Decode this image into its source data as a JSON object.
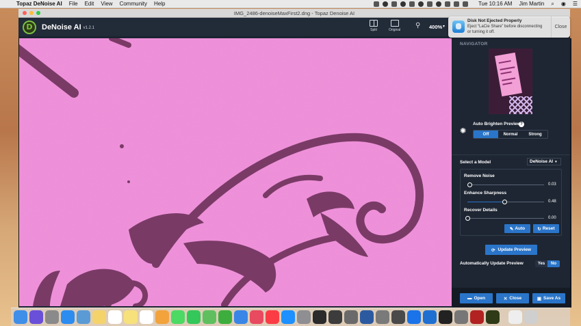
{
  "menubar": {
    "app_name": "Topaz DeNoise AI",
    "menus": [
      "File",
      "Edit",
      "View",
      "Community",
      "Help"
    ],
    "clock": "Tue 10:16 AM",
    "user": "Jim Martin"
  },
  "window": {
    "title": "IMG_2486-denoiseMaxFirst2.dng - Topaz Denoise AI"
  },
  "toolbar": {
    "logo_letter": "D",
    "app_title": "DeNoise AI",
    "version": "v1.2.1",
    "split_label": "Split",
    "original_label": "Original",
    "zoom_level": "400%"
  },
  "notification": {
    "title": "Disk Not Ejected Properly",
    "body": "Eject “LaCie Share” before disconnecting or turning it off.",
    "close_label": "Close"
  },
  "panel": {
    "navigator_label": "NAVIGATOR",
    "auto_brighten": {
      "label": "Auto Brighten Preview",
      "help": "?",
      "options": [
        "Off",
        "Normal",
        "Strong"
      ],
      "selected": "Off"
    },
    "model": {
      "label": "Select a Model",
      "selected": "DeNoise AI"
    },
    "sliders": [
      {
        "label": "Remove Noise",
        "value": "0.03",
        "fraction": 0.03
      },
      {
        "label": "Enhance Sharpness",
        "value": "0.48",
        "fraction": 0.48
      },
      {
        "label": "Recover Details",
        "value": "0.00",
        "fraction": 0.0
      }
    ],
    "auto_label": "Auto",
    "reset_label": "Reset",
    "update_preview_label": "Update Preview",
    "auto_update": {
      "label": "Automatically Update Preview",
      "options": [
        "Yes",
        "No"
      ],
      "selected": "No"
    },
    "bottom": {
      "open_label": "Open",
      "close_label": "Close",
      "save_as_label": "Save As"
    }
  },
  "colors": {
    "accent": "#2a75c9",
    "panel_bg": "#1e2633",
    "image_bg": "#ef8fda",
    "image_ink": "#7a3a66"
  },
  "dock_icons": [
    "finder",
    "siri",
    "launchpad",
    "safari",
    "preview",
    "notes",
    "calendar",
    "stickies",
    "reminders",
    "photos",
    "messages",
    "facetime",
    "maps",
    "numbers",
    "keynote",
    "news",
    "music",
    "app-store",
    "system-preferences",
    "topaz-app",
    "camera-raw",
    "image-capture",
    "photoshop",
    "keychain",
    "finder-migration",
    "teamviewer",
    "xcode",
    "terminal",
    "disk-utility",
    "security-app",
    "denoise-app",
    "documents",
    "trash"
  ]
}
